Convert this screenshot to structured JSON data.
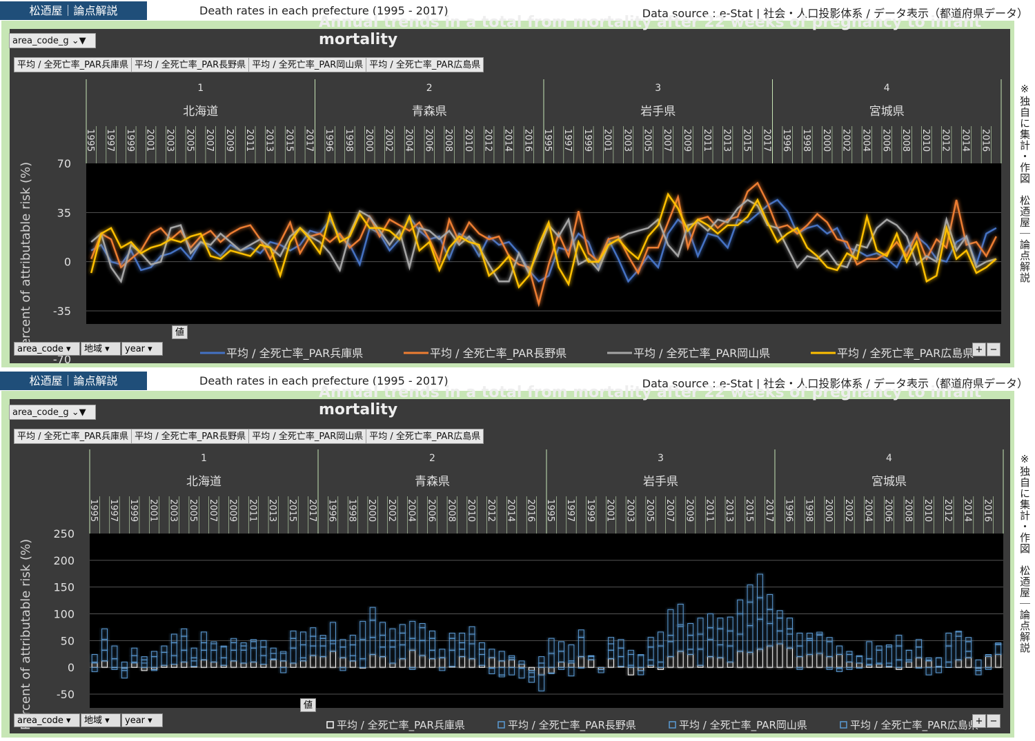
{
  "header": {
    "brand": "松迺屋｜論点解説",
    "title": "Death rates in each prefecture (1995 - 2017)",
    "source": "Data source : e-Stat | 社会・人口投影体系 / データ表示（都道府県データ）"
  },
  "side_note": "※独自に集計・作図　松迺屋｜論点解説",
  "controls": {
    "filter_field": "area_code_g",
    "value_label": "値",
    "row_fields": [
      "area_code",
      "地域",
      "year"
    ],
    "series_buttons": [
      "平均 / 全死亡率_PAR兵庫県",
      "平均 / 全死亡率_PAR長野県",
      "平均 / 全死亡率_PAR岡山県",
      "平均 / 全死亡率_PAR広島県"
    ],
    "plus": "+",
    "minus": "−"
  },
  "groups": [
    {
      "code": "1",
      "name": "北海道"
    },
    {
      "code": "2",
      "name": "青森県"
    },
    {
      "code": "3",
      "name": "岩手県"
    },
    {
      "code": "4",
      "name": "宮城県"
    }
  ],
  "year_labels": [
    "1995",
    "1997",
    "1999",
    "2001",
    "2003",
    "2005",
    "2007",
    "2009",
    "2011",
    "2013",
    "2015",
    "2017",
    "1996",
    "1998",
    "2000",
    "2002",
    "2004",
    "2006",
    "2008",
    "2010",
    "2012",
    "2014",
    "2016",
    "1995",
    "1997",
    "1999",
    "2001",
    "2003",
    "2005",
    "2007",
    "2009",
    "2011",
    "2013",
    "2015",
    "2017",
    "1996",
    "1998",
    "2000",
    "2002",
    "2004",
    "2006",
    "2008",
    "2010",
    "2012",
    "2014",
    "2016"
  ],
  "colors": {
    "hyogo": "#4472c4",
    "nagano": "#ed7d31",
    "okayama": "#a5a5a5",
    "hiroshima": "#ffc000",
    "bars": "#5b9bd5"
  },
  "chart_data": [
    {
      "type": "line",
      "title": "Annual trends in a total from mortality after 22 weeks of pregnancy to infant mortality",
      "ylabel": "Percent of attributable risk (%)",
      "ylim": [
        -35,
        70
      ],
      "yticks": [
        70,
        35,
        0,
        -35
      ],
      "yticks_extra": "-70",
      "x_count": 92,
      "series": [
        {
          "name": "平均 / 全死亡率_PAR兵庫県",
          "values": [
            8,
            12,
            0,
            -2,
            8,
            -6,
            -4,
            4,
            6,
            10,
            2,
            14,
            10,
            4,
            12,
            8,
            10,
            6,
            14,
            12,
            8,
            12,
            22,
            20,
            30,
            18,
            12,
            -2,
            24,
            20,
            8,
            16,
            32,
            22,
            16,
            18,
            2,
            20,
            16,
            4,
            18,
            12,
            14,
            6,
            -6,
            -14,
            -10,
            10,
            8,
            20,
            14,
            -4,
            16,
            2,
            -14,
            -6,
            4,
            -4,
            20,
            30,
            24,
            4,
            20,
            18,
            10,
            30,
            28,
            34,
            40,
            44,
            36,
            20,
            24,
            26,
            20,
            24,
            10,
            8,
            4,
            6,
            2,
            -4,
            10,
            18,
            12,
            2,
            0,
            14,
            18,
            -2,
            20,
            24
          ]
        },
        {
          "name": "平均 / 全死亡率_PAR長野県",
          "values": [
            2,
            20,
            16,
            -4,
            2,
            8,
            20,
            24,
            16,
            22,
            10,
            18,
            22,
            14,
            20,
            24,
            26,
            16,
            2,
            14,
            28,
            6,
            18,
            20,
            14,
            20,
            10,
            16,
            32,
            18,
            30,
            26,
            22,
            28,
            16,
            0,
            30,
            14,
            28,
            20,
            16,
            18,
            4,
            -2,
            -4,
            -30,
            -2,
            20,
            4,
            36,
            6,
            0,
            16,
            18,
            4,
            -8,
            10,
            10,
            28,
            46,
            10,
            30,
            32,
            24,
            30,
            32,
            50,
            56,
            42,
            24,
            26,
            20,
            26,
            34,
            28,
            16,
            14,
            -2,
            2,
            2,
            6,
            14,
            4,
            20,
            2,
            16,
            10,
            44,
            12,
            14,
            4,
            18
          ]
        },
        {
          "name": "平均 / 全死亡率_PAR岡山県",
          "values": [
            14,
            20,
            -4,
            -14,
            12,
            6,
            -2,
            0,
            24,
            26,
            6,
            14,
            12,
            20,
            14,
            8,
            12,
            16,
            10,
            4,
            18,
            24,
            18,
            14,
            6,
            -6,
            20,
            36,
            32,
            22,
            12,
            22,
            -4,
            24,
            22,
            16,
            22,
            12,
            18,
            10,
            -2,
            -14,
            -14,
            6,
            -8,
            8,
            26,
            18,
            30,
            -2,
            2,
            -6,
            12,
            16,
            20,
            22,
            24,
            30,
            12,
            4,
            26,
            28,
            22,
            30,
            28,
            38,
            44,
            40,
            26,
            24,
            10,
            -4,
            4,
            2,
            8,
            -2,
            -4,
            12,
            10,
            24,
            30,
            26,
            18,
            -2,
            4,
            0,
            30,
            8,
            18,
            -4,
            0,
            2
          ]
        },
        {
          "name": "平均 / 全死亡率_PAR広島県",
          "values": [
            -8,
            20,
            24,
            10,
            14,
            6,
            10,
            12,
            16,
            14,
            18,
            20,
            4,
            2,
            8,
            6,
            4,
            12,
            10,
            -10,
            14,
            24,
            16,
            6,
            34,
            14,
            18,
            34,
            24,
            24,
            22,
            16,
            32,
            8,
            14,
            -6,
            10,
            18,
            14,
            12,
            -10,
            -4,
            4,
            -18,
            -10,
            12,
            28,
            -4,
            -16,
            14,
            0,
            0,
            12,
            16,
            8,
            2,
            18,
            26,
            48,
            38,
            22,
            30,
            26,
            20,
            26,
            26,
            32,
            44,
            28,
            14,
            20,
            24,
            10,
            4,
            -4,
            -6,
            6,
            2,
            32,
            8,
            4,
            20,
            0,
            14,
            -14,
            -10,
            24,
            2,
            8,
            -8,
            -4,
            2
          ]
        }
      ]
    },
    {
      "type": "bar",
      "stacked": true,
      "title": "Annual trends in a total from mortality after 22 weeks of pregnancy to infant mortality",
      "ylabel": "Percent of attributable risk (%)",
      "ylim": [
        -50,
        250
      ],
      "yticks": [
        250,
        200,
        150,
        100,
        50,
        0,
        -50
      ],
      "x_count": 92,
      "series_names": [
        "平均 / 全死亡率_PAR兵庫県",
        "平均 / 全死亡率_PAR長野県",
        "平均 / 全死亡率_PAR岡山県",
        "平均 / 全死亡率_PAR広島県"
      ],
      "note": "stacked totals of the four series above"
    }
  ]
}
